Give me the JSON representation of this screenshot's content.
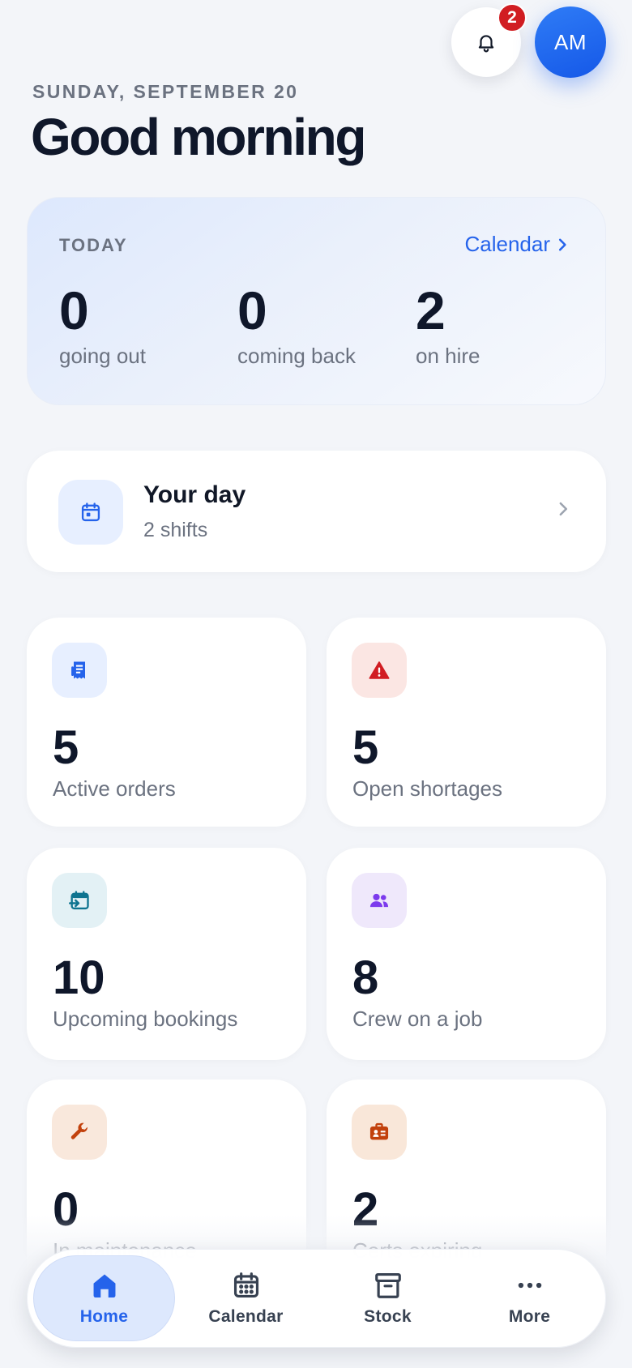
{
  "header": {
    "date": "SUNDAY, SEPTEMBER 20",
    "greeting": "Good morning",
    "notification_count": "2",
    "avatar_initials": "AM"
  },
  "today": {
    "label": "TODAY",
    "calendar_link": "Calendar",
    "stats": [
      {
        "value": "0",
        "label": "going out"
      },
      {
        "value": "0",
        "label": "coming back"
      },
      {
        "value": "2",
        "label": "on hire"
      }
    ]
  },
  "your_day": {
    "title": "Your day",
    "subtitle": "2 shifts"
  },
  "tiles": [
    {
      "value": "5",
      "label": "Active orders",
      "icon": "receipt-icon",
      "color": "#2563eb"
    },
    {
      "value": "5",
      "label": "Open shortages",
      "icon": "warning-icon",
      "color": "#d11d22"
    },
    {
      "value": "10",
      "label": "Upcoming bookings",
      "icon": "calendar-arrow-icon",
      "color": "#0e7490"
    },
    {
      "value": "8",
      "label": "Crew on a job",
      "icon": "users-icon",
      "color": "#7c3aed"
    },
    {
      "value": "0",
      "label": "In maintenance",
      "icon": "wrench-icon",
      "color": "#c2410c"
    },
    {
      "value": "2",
      "label": "Certs expiring",
      "icon": "id-badge-icon",
      "color": "#c2410c"
    }
  ],
  "nav": [
    {
      "label": "Home",
      "icon": "home-icon",
      "active": true
    },
    {
      "label": "Calendar",
      "icon": "calendar-icon",
      "active": false
    },
    {
      "label": "Stock",
      "icon": "archive-box-icon",
      "active": false
    },
    {
      "label": "More",
      "icon": "more-dots-icon",
      "active": false
    }
  ],
  "colors": {
    "accent": "#2563eb",
    "badge": "#d11d22",
    "background": "#f3f5f9"
  }
}
